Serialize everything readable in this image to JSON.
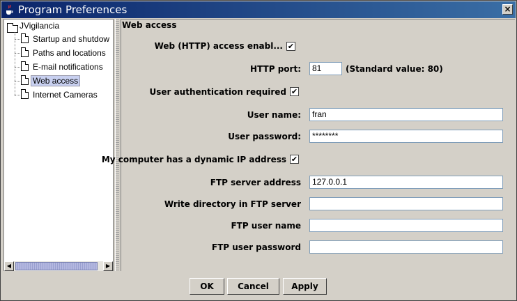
{
  "window": {
    "title": "Program Preferences",
    "close_label": "×"
  },
  "tree": {
    "root": "JVigilancia",
    "items": [
      {
        "label": "Startup and shutdow"
      },
      {
        "label": "Paths and locations"
      },
      {
        "label": "E-mail notifications"
      },
      {
        "label": "Web access",
        "selected": true
      },
      {
        "label": "Internet Cameras"
      }
    ]
  },
  "panel": {
    "title": "Web access",
    "web_access_label": "Web (HTTP) access enabl...",
    "web_access_checked": true,
    "http_port_label": "HTTP port:",
    "http_port_value": "81",
    "http_port_hint": "(Standard value: 80)",
    "auth_label": "User authentication required",
    "auth_checked": true,
    "user_name_label": "User name:",
    "user_name_value": "fran",
    "user_password_label": "User password:",
    "user_password_value": "********",
    "dynamic_ip_label": "My computer has a dynamic IP address",
    "dynamic_ip_checked": true,
    "ftp_server_label": "FTP server address",
    "ftp_server_value": "127.0.0.1",
    "ftp_dir_label": "Write directory in FTP server",
    "ftp_dir_value": "",
    "ftp_user_label": "FTP user name",
    "ftp_user_value": "",
    "ftp_password_label": "FTP user password",
    "ftp_password_value": ""
  },
  "buttons": {
    "ok": "OK",
    "cancel": "Cancel",
    "apply": "Apply"
  },
  "colors": {
    "titlebar": "#0a246a",
    "background": "#d4d0c8"
  }
}
